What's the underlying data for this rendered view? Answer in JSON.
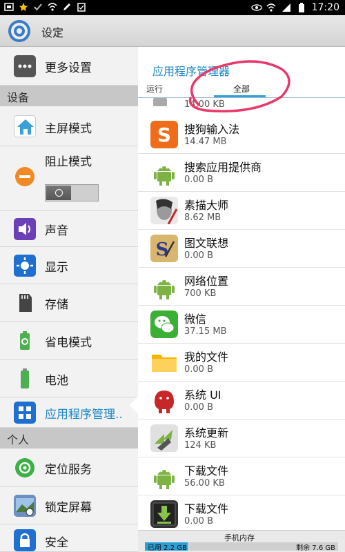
{
  "status_bar": {
    "time": "17:20",
    "left_icons": [
      "screenshot-icon",
      "star-icon",
      "check-icon",
      "wifi-icon",
      "pen-icon",
      "clipboard-icon"
    ],
    "right_icons": [
      "eye-icon",
      "wifi-icon",
      "signal-icon",
      "battery-icon"
    ]
  },
  "action_bar": {
    "title": "设定"
  },
  "left_pane": {
    "top_item": {
      "label": "更多设置",
      "icon": "more-icon"
    },
    "section_device": "设备",
    "items": [
      {
        "label": "主屏模式",
        "icon": "home-icon"
      },
      {
        "label": "阻止模式",
        "icon": "block-icon"
      },
      {
        "label": "声音",
        "icon": "sound-icon"
      },
      {
        "label": "显示",
        "icon": "display-icon"
      },
      {
        "label": "存储",
        "icon": "storage-icon"
      },
      {
        "label": "省电模式",
        "icon": "power-saving-icon"
      },
      {
        "label": "电池",
        "icon": "battery-icon"
      },
      {
        "label": "应用程序管理..",
        "icon": "apps-icon",
        "selected": true
      }
    ],
    "section_personal": "个人",
    "personal_items": [
      {
        "label": "定位服务",
        "icon": "location-icon"
      },
      {
        "label": "锁定屏幕",
        "icon": "lock-screen-icon"
      },
      {
        "label": "安全",
        "icon": "security-icon"
      }
    ]
  },
  "right_pane": {
    "title": "应用程序管理器",
    "tabs": [
      {
        "label": "运行"
      },
      {
        "label": "全部",
        "active": true
      }
    ],
    "partial_size": "14.00 KB",
    "apps": [
      {
        "name": "搜狗输入法",
        "size": "14.47 MB",
        "icon": "sogou-icon"
      },
      {
        "name": "搜索应用提供商",
        "size": "0.00 B",
        "icon": "android-icon"
      },
      {
        "name": "素描大师",
        "size": "8.62 MB",
        "icon": "sketch-icon"
      },
      {
        "name": "图文联想",
        "size": "0.00 B",
        "icon": "text-link-icon"
      },
      {
        "name": "网络位置",
        "size": "700 KB",
        "icon": "android-icon"
      },
      {
        "name": "微信",
        "size": "37.15 MB",
        "icon": "wechat-icon"
      },
      {
        "name": "我的文件",
        "size": "0.00 B",
        "icon": "folder-icon"
      },
      {
        "name": "系统 UI",
        "size": "0.00 B",
        "icon": "jellybean-icon"
      },
      {
        "name": "系统更新",
        "size": "124 KB",
        "icon": "system-update-icon"
      },
      {
        "name": "下载文件",
        "size": "56.00 KB",
        "icon": "android-icon"
      },
      {
        "name": "下载文件",
        "size": "0.00 B",
        "icon": "download-icon"
      }
    ]
  },
  "storage": {
    "title": "手机内存",
    "used_label": "已用 2.2 GB",
    "free_label": "剩余 7.6 GB",
    "used_fraction": 0.22
  },
  "colors": {
    "accent": "#1e88c8",
    "selected": "#1e88c8",
    "annotation": "#e8386a"
  }
}
